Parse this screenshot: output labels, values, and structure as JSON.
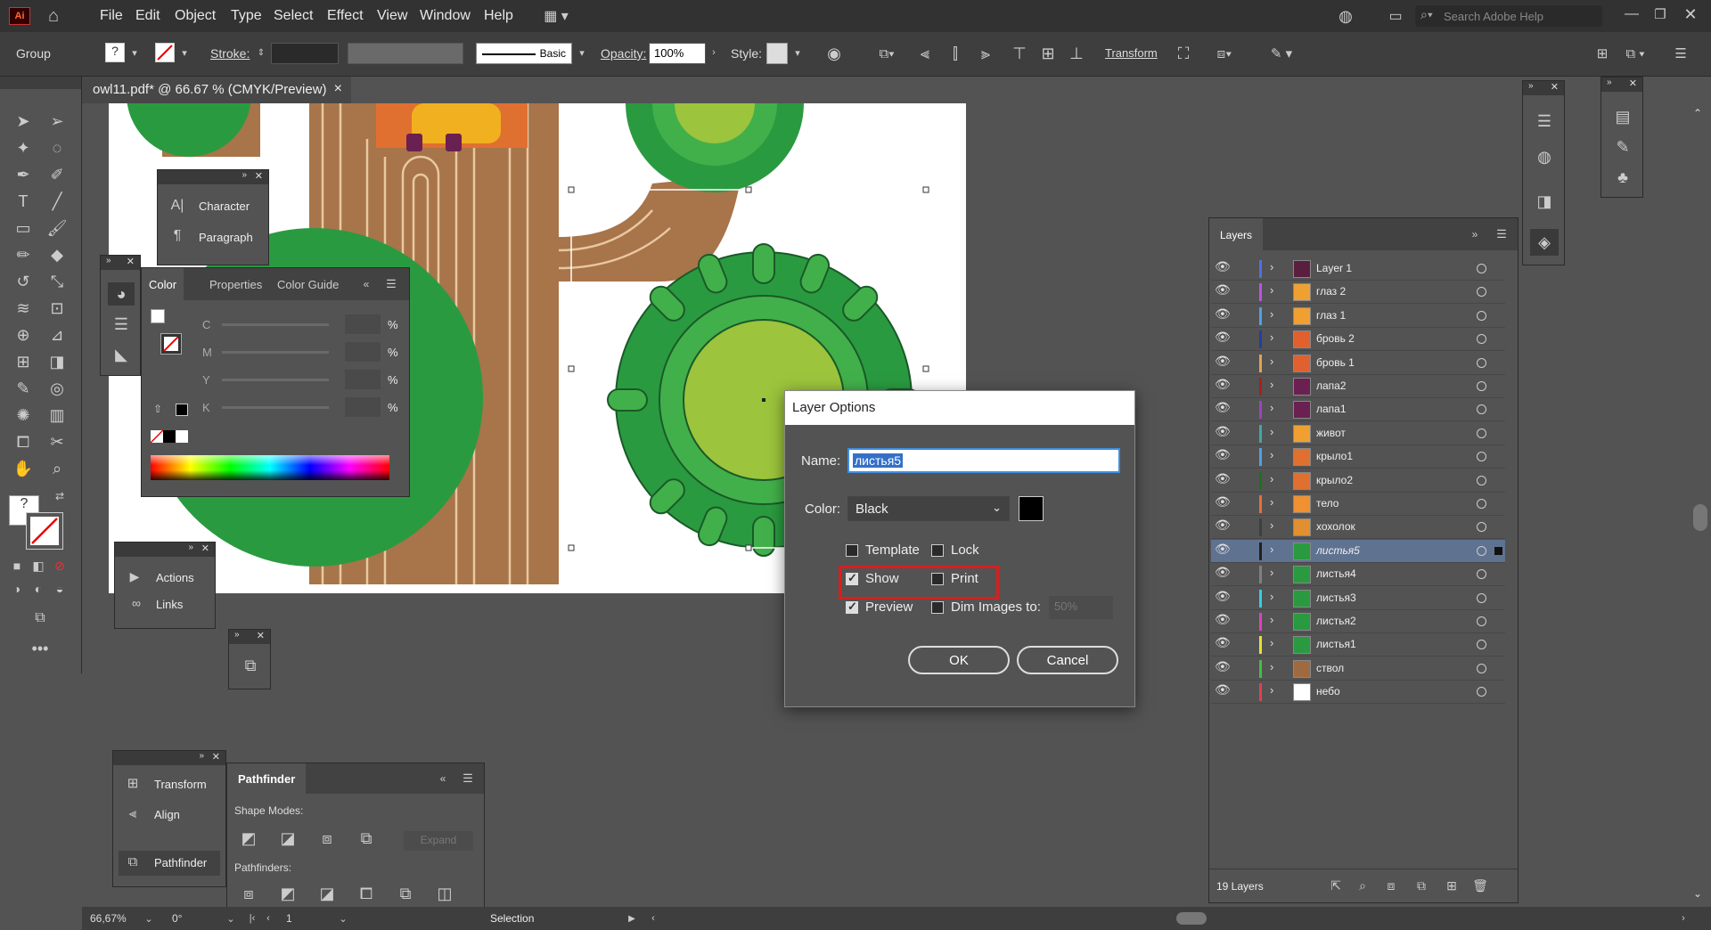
{
  "app": {
    "logo": "Ai"
  },
  "menu": [
    "File",
    "Edit",
    "Object",
    "Type",
    "Select",
    "Effect",
    "View",
    "Window",
    "Help"
  ],
  "search": {
    "placeholder": "Search Adobe Help"
  },
  "control": {
    "selection_type": "Group",
    "stroke_label": "Stroke:",
    "brush_label": "Basic",
    "opacity_label": "Opacity:",
    "opacity_value": "100%",
    "style_label": "Style:",
    "transform_label": "Transform"
  },
  "doc_tab": {
    "title": "owl11.pdf* @ 66.67 % (CMYK/Preview)",
    "close": "×"
  },
  "char_panel": {
    "items": [
      "Character",
      "Paragraph"
    ]
  },
  "color_panel": {
    "tabs": [
      "Color",
      "Properties",
      "Color Guide"
    ],
    "channels": [
      "C",
      "M",
      "Y",
      "K"
    ],
    "unit": "%"
  },
  "actions_panel": {
    "items": [
      "Actions",
      "Links"
    ]
  },
  "bottom_panel": {
    "items": [
      "Transform",
      "Align",
      "Pathfinder"
    ]
  },
  "pathfinder": {
    "title": "Pathfinder",
    "shape_modes": "Shape Modes:",
    "expand": "Expand",
    "pathfinders": "Pathfinders:"
  },
  "layers": {
    "title": "Layers",
    "count": "19 Layers",
    "items": [
      {
        "name": "Layer 1",
        "color": "#4f6fe8",
        "thumb": "#5a1f3f"
      },
      {
        "name": "глаз 2",
        "color": "#c04fe8",
        "thumb": "#f0a030"
      },
      {
        "name": "глаз 1",
        "color": "#4fa0e8",
        "thumb": "#f0a030"
      },
      {
        "name": "бровь 2",
        "color": "#1f3fa8",
        "thumb": "#e06030"
      },
      {
        "name": "бровь 1",
        "color": "#e8a04f",
        "thumb": "#e06030"
      },
      {
        "name": "лапа2",
        "color": "#a82020",
        "thumb": "#6a2050"
      },
      {
        "name": "лапа1",
        "color": "#a040c0",
        "thumb": "#6a2050"
      },
      {
        "name": "живот",
        "color": "#3fa8a8",
        "thumb": "#f0a030"
      },
      {
        "name": "крыло1",
        "color": "#4fa0e8",
        "thumb": "#e07030"
      },
      {
        "name": "крыло2",
        "color": "#207020",
        "thumb": "#e07030"
      },
      {
        "name": "тело",
        "color": "#e87030",
        "thumb": "#f09030"
      },
      {
        "name": "хохолок",
        "color": "#3f3f3f",
        "thumb": "#e09030"
      },
      {
        "name": "листья5",
        "color": "#202020",
        "thumb": "#2a9a40"
      },
      {
        "name": "листья4",
        "color": "#808080",
        "thumb": "#2a9a40"
      },
      {
        "name": "листья3",
        "color": "#30d0e0",
        "thumb": "#2a9a40"
      },
      {
        "name": "листья2",
        "color": "#e040c0",
        "thumb": "#2a9a40"
      },
      {
        "name": "листья1",
        "color": "#e8e030",
        "thumb": "#2a9a40"
      },
      {
        "name": "ствол",
        "color": "#40c040",
        "thumb": "#a06a40"
      },
      {
        "name": "небо",
        "color": "#e04050",
        "thumb": "#ffffff"
      }
    ],
    "selected_index": 12
  },
  "dialog": {
    "title": "Layer Options",
    "name_label": "Name:",
    "name_value": "листья5",
    "color_label": "Color:",
    "color_value": "Black",
    "template": "Template",
    "lock": "Lock",
    "show": "Show",
    "print": "Print",
    "preview": "Preview",
    "dim": "Dim Images to:",
    "dim_value": "50%",
    "ok": "OK",
    "cancel": "Cancel"
  },
  "status": {
    "zoom": "66,67%",
    "rotation": "0°",
    "artboard": "1",
    "tool": "Selection"
  }
}
